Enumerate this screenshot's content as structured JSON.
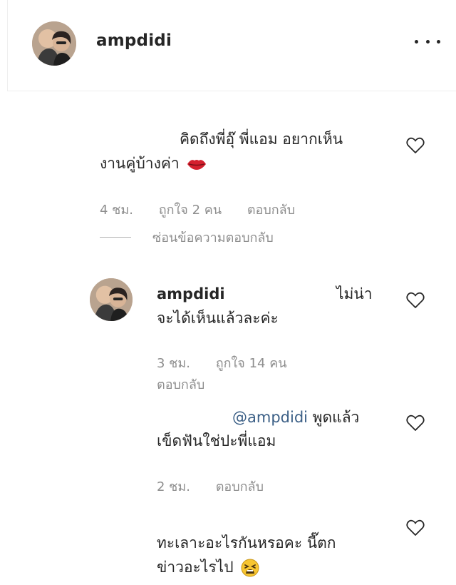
{
  "header": {
    "username": "ampdidi",
    "more_icon": "more-options-icon"
  },
  "comments": [
    {
      "line1": "คิดถึงพี่อุ๊ พี่แอม อยากเห็น",
      "line2": "งานคู่บ้างค่า",
      "emoji": "kiss-lips-icon",
      "time": "4 ชม.",
      "likes": "ถูกใจ 2 คน",
      "reply": "ตอบกลับ",
      "hide_replies": "ซ่อนข้อความตอบกลับ"
    },
    {
      "username": "ampdidi",
      "line1_end": "ไม่น่า",
      "line2": "จะได้เห็นแล้วละค่ะ",
      "time": "3 ชม.",
      "likes": "ถูกใจ 14 คน",
      "reply": "ตอบกลับ"
    },
    {
      "mention": "@ampdidi",
      "line1_end": "พูดแล้ว",
      "line2": "เข็ดฟันใช่ปะพี่แอม",
      "time": "2 ชม.",
      "reply": "ตอบกลับ"
    },
    {
      "line1": "ทะเลาะอะไรกันหรอคะ นี๊ตก",
      "line2": "ข่าวอะไรไป",
      "emoji": "tired-face-icon"
    }
  ],
  "colors": {
    "text": "#262626",
    "meta": "#8e8e8e",
    "mention": "#3b5f86",
    "divider": "#efefef"
  }
}
